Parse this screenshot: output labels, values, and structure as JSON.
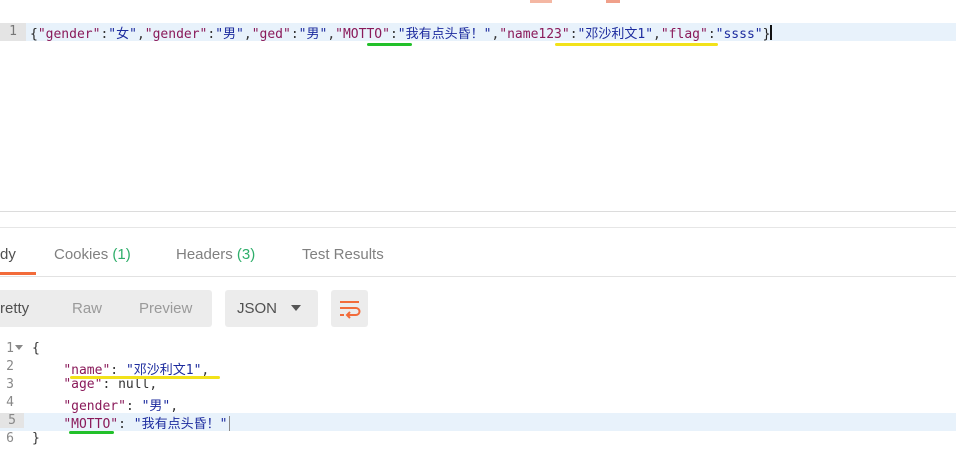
{
  "request": {
    "line_number": "1",
    "tokens": [
      {
        "t": "{",
        "c": "b"
      },
      {
        "t": "\"gender\"",
        "c": "k"
      },
      {
        "t": ":",
        "c": "p"
      },
      {
        "t": "\"女\"",
        "c": "s"
      },
      {
        "t": ",",
        "c": "p"
      },
      {
        "t": "\"gender\"",
        "c": "k"
      },
      {
        "t": ":",
        "c": "p"
      },
      {
        "t": "\"男\"",
        "c": "s"
      },
      {
        "t": ",",
        "c": "p"
      },
      {
        "t": "\"ged\"",
        "c": "k"
      },
      {
        "t": ":",
        "c": "p"
      },
      {
        "t": "\"男\"",
        "c": "s"
      },
      {
        "t": ",",
        "c": "p"
      },
      {
        "t": "\"MOTTO\"",
        "c": "k"
      },
      {
        "t": ":",
        "c": "p"
      },
      {
        "t": "\"我有点头昏！\"",
        "c": "s"
      },
      {
        "t": ",",
        "c": "p"
      },
      {
        "t": "\"name123\"",
        "c": "k"
      },
      {
        "t": ":",
        "c": "p"
      },
      {
        "t": "\"邓沙利文1\"",
        "c": "s"
      },
      {
        "t": ",",
        "c": "p"
      },
      {
        "t": "\"flag\"",
        "c": "k"
      },
      {
        "t": ":",
        "c": "p"
      },
      {
        "t": "\"ssss\"",
        "c": "s"
      },
      {
        "t": "}",
        "c": "b"
      }
    ]
  },
  "tabs": [
    {
      "label": "dy",
      "count": "",
      "active": true
    },
    {
      "label": "Cookies",
      "count": "(1)",
      "active": false
    },
    {
      "label": "Headers",
      "count": "(3)",
      "active": false
    },
    {
      "label": "Test Results",
      "count": "",
      "active": false
    }
  ],
  "toolbar": {
    "view_modes": [
      "Pretty",
      "Raw",
      "Preview"
    ],
    "active_view": "Pretty",
    "format_selected": "JSON",
    "wrap_icon": "wrap-lines-icon"
  },
  "response": {
    "lines": [
      {
        "num": "1",
        "fold": true,
        "indent": "",
        "key": "",
        "value": "",
        "text": "{",
        "highlight": false
      },
      {
        "num": "2",
        "fold": false,
        "indent": "    ",
        "key": "\"name\"",
        "sep": ": ",
        "value": "\"邓沙利文1\"",
        "vclass": "s",
        "tail": ",",
        "highlight": false
      },
      {
        "num": "3",
        "fold": false,
        "indent": "    ",
        "key": "\"age\"",
        "sep": ": ",
        "value": "null",
        "vclass": "n",
        "tail": ",",
        "highlight": false
      },
      {
        "num": "4",
        "fold": false,
        "indent": "    ",
        "key": "\"gender\"",
        "sep": ": ",
        "value": "\"男\"",
        "vclass": "s",
        "tail": ",",
        "highlight": false
      },
      {
        "num": "5",
        "fold": false,
        "indent": "    ",
        "key": "\"MOTTO\"",
        "sep": ": ",
        "value": "\"我有点头昏！\"",
        "vclass": "s",
        "tail": "",
        "highlight": true
      },
      {
        "num": "6",
        "fold": false,
        "indent": "",
        "key": "",
        "value": "",
        "text": "}",
        "highlight": false
      }
    ]
  },
  "colors": {
    "accent": "#f26b3a",
    "count_green": "#2eae6a",
    "annotation_green": "#22c02a",
    "annotation_yellow": "#f2e21a",
    "json_key": "#8a1a5a",
    "json_string": "#1c2b9e"
  }
}
